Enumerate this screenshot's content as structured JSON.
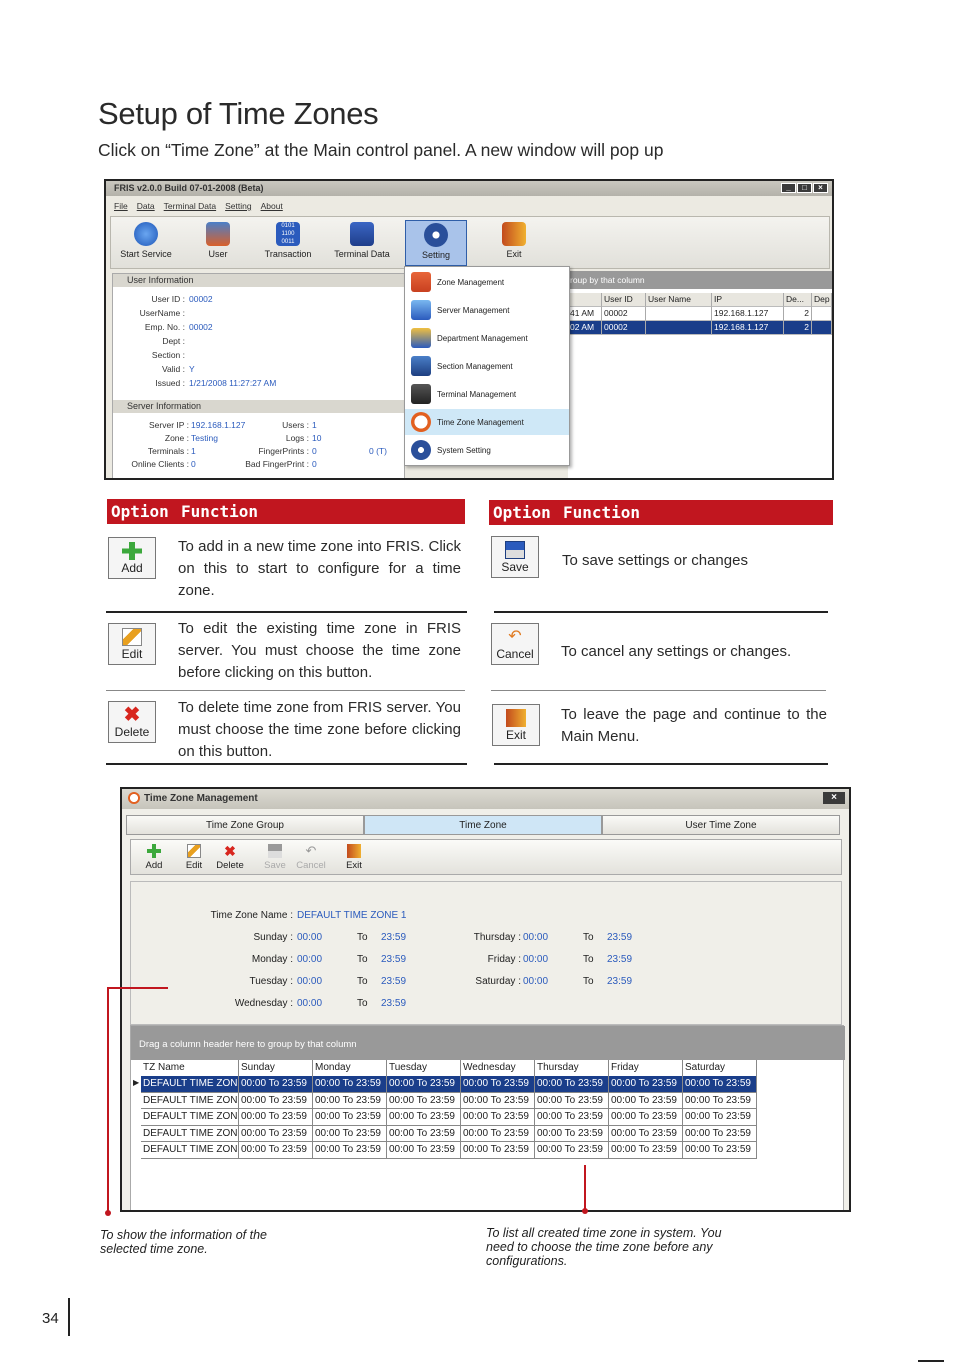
{
  "page": {
    "title": "Setup of Time Zones",
    "subtitle": "Click on “Time Zone” at the Main control panel. A new window will pop up",
    "page_number": "34"
  },
  "app": {
    "title": "FRIS v2.0.0  Build 07-01-2008 (Beta)",
    "menu": [
      "File",
      "Data",
      "Terminal Data",
      "Setting",
      "About"
    ],
    "toolbar": [
      "Start Service",
      "User",
      "Transaction",
      "Terminal Data",
      "Setting",
      "Exit"
    ],
    "user_info": {
      "header": "User Information",
      "rows": [
        {
          "label": "User ID :",
          "value": "00002"
        },
        {
          "label": "UserName :",
          "value": ""
        },
        {
          "label": "Emp. No. :",
          "value": "00002"
        },
        {
          "label": "Dept :",
          "value": ""
        },
        {
          "label": "Section :",
          "value": ""
        },
        {
          "label": "Valid :",
          "value": "Y"
        },
        {
          "label": "Issued :",
          "value": "1/21/2008 11:27:27 AM"
        }
      ]
    },
    "server_info": {
      "header": "Server Information",
      "server_ip_label": "Server IP :",
      "server_ip": "192.168.1.127",
      "zone_label": "Zone :",
      "zone": "Testing",
      "terminals_label": "Terminals :",
      "terminals": "1",
      "online_label": "Online Clients :",
      "online": "0",
      "users_label": "Users :",
      "users": "1",
      "logs_label": "Logs :",
      "logs": "10",
      "fp_label": "FingerPrints :",
      "fp": "0",
      "fp_t": "0 (T)",
      "badfp_label": "Bad FingerPrint :",
      "badfp": "0"
    },
    "dropdown": [
      "Zone Management",
      "Server Management",
      "Department Management",
      "Section Management",
      "Terminal Management",
      "Time Zone Management",
      "System Setting"
    ],
    "grid": {
      "group_hint": "roup by that column",
      "headers": [
        "",
        "User ID",
        "User Name",
        "IP",
        "De...",
        "Dep"
      ],
      "rows": [
        [
          "41 AM",
          "00002",
          "",
          "192.168.1.127",
          "2",
          ""
        ],
        [
          "02 AM",
          "00002",
          "",
          "192.168.1.127",
          "2",
          ""
        ]
      ]
    }
  },
  "options_left": {
    "header_option": "Option",
    "header_function": "Function",
    "items": [
      {
        "button": "Add",
        "text": "To add in a new time zone into FRIS. Click on this to start to configure for a time zone."
      },
      {
        "button": "Edit",
        "text": "To edit the existing time zone in FRIS server. You must choose the time zone before clicking on this button."
      },
      {
        "button": "Delete",
        "text": "To delete time zone from FRIS server. You must choose the time zone before clicking on this button."
      }
    ]
  },
  "options_right": {
    "header_option": "Option",
    "header_function": "Function",
    "items": [
      {
        "button": "Save",
        "text": "To save settings or changes"
      },
      {
        "button": "Cancel",
        "text": "To cancel any settings or changes."
      },
      {
        "button": "Exit",
        "text": "To leave the page and continue to the Main Menu."
      }
    ]
  },
  "tz_window": {
    "title": "Time Zone Management",
    "tabs": [
      "Time Zone Group",
      "Time Zone",
      "User Time Zone"
    ],
    "toolbar": [
      {
        "label": "Add",
        "enabled": true
      },
      {
        "label": "Edit",
        "enabled": true
      },
      {
        "label": "Delete",
        "enabled": true
      },
      {
        "label": "Save",
        "enabled": false
      },
      {
        "label": "Cancel",
        "enabled": false
      },
      {
        "label": "Exit",
        "enabled": true
      }
    ],
    "form": {
      "name_label": "Time Zone Name :",
      "name_value": "DEFAULT TIME ZONE 1",
      "to_label": "To",
      "days": [
        {
          "label": "Sunday :",
          "from": "00:00",
          "to": "23:59"
        },
        {
          "label": "Monday :",
          "from": "00:00",
          "to": "23:59"
        },
        {
          "label": "Tuesday :",
          "from": "00:00",
          "to": "23:59"
        },
        {
          "label": "Wednesday :",
          "from": "00:00",
          "to": "23:59"
        },
        {
          "label": "Thursday :",
          "from": "00:00",
          "to": "23:59"
        },
        {
          "label": "Friday :",
          "from": "00:00",
          "to": "23:59"
        },
        {
          "label": "Saturday :",
          "from": "00:00",
          "to": "23:59"
        }
      ]
    },
    "grid": {
      "group_hint": "Drag a column header here to group by that column",
      "headers": [
        "TZ Name",
        "Sunday",
        "Monday",
        "Tuesday",
        "Wednesday",
        "Thursday",
        "Friday",
        "Saturday"
      ],
      "rows": [
        [
          "DEFAULT TIME ZON",
          "00:00 To 23:59",
          "00:00 To 23:59",
          "00:00 To 23:59",
          "00:00 To 23:59",
          "00:00 To 23:59",
          "00:00 To 23:59",
          "00:00 To 23:59"
        ],
        [
          "DEFAULT TIME ZON",
          "00:00 To 23:59",
          "00:00 To 23:59",
          "00:00 To 23:59",
          "00:00 To 23:59",
          "00:00 To 23:59",
          "00:00 To 23:59",
          "00:00 To 23:59"
        ],
        [
          "DEFAULT TIME ZON",
          "00:00 To 23:59",
          "00:00 To 23:59",
          "00:00 To 23:59",
          "00:00 To 23:59",
          "00:00 To 23:59",
          "00:00 To 23:59",
          "00:00 To 23:59"
        ],
        [
          "DEFAULT TIME ZON",
          "00:00 To 23:59",
          "00:00 To 23:59",
          "00:00 To 23:59",
          "00:00 To 23:59",
          "00:00 To 23:59",
          "00:00 To 23:59",
          "00:00 To 23:59"
        ],
        [
          "DEFAULT TIME ZON",
          "00:00 To 23:59",
          "00:00 To 23:59",
          "00:00 To 23:59",
          "00:00 To 23:59",
          "00:00 To 23:59",
          "00:00 To 23:59",
          "00:00 To 23:59"
        ]
      ]
    }
  },
  "captions": {
    "left": "To show the information of the selected time zone.",
    "right": "To list all created time zone in system. You need to choose the time zone before any configurations."
  },
  "colors": {
    "accent_red": "#c1161f",
    "selection_blue": "#1a3e8a",
    "value_blue": "#2b5bbd"
  }
}
